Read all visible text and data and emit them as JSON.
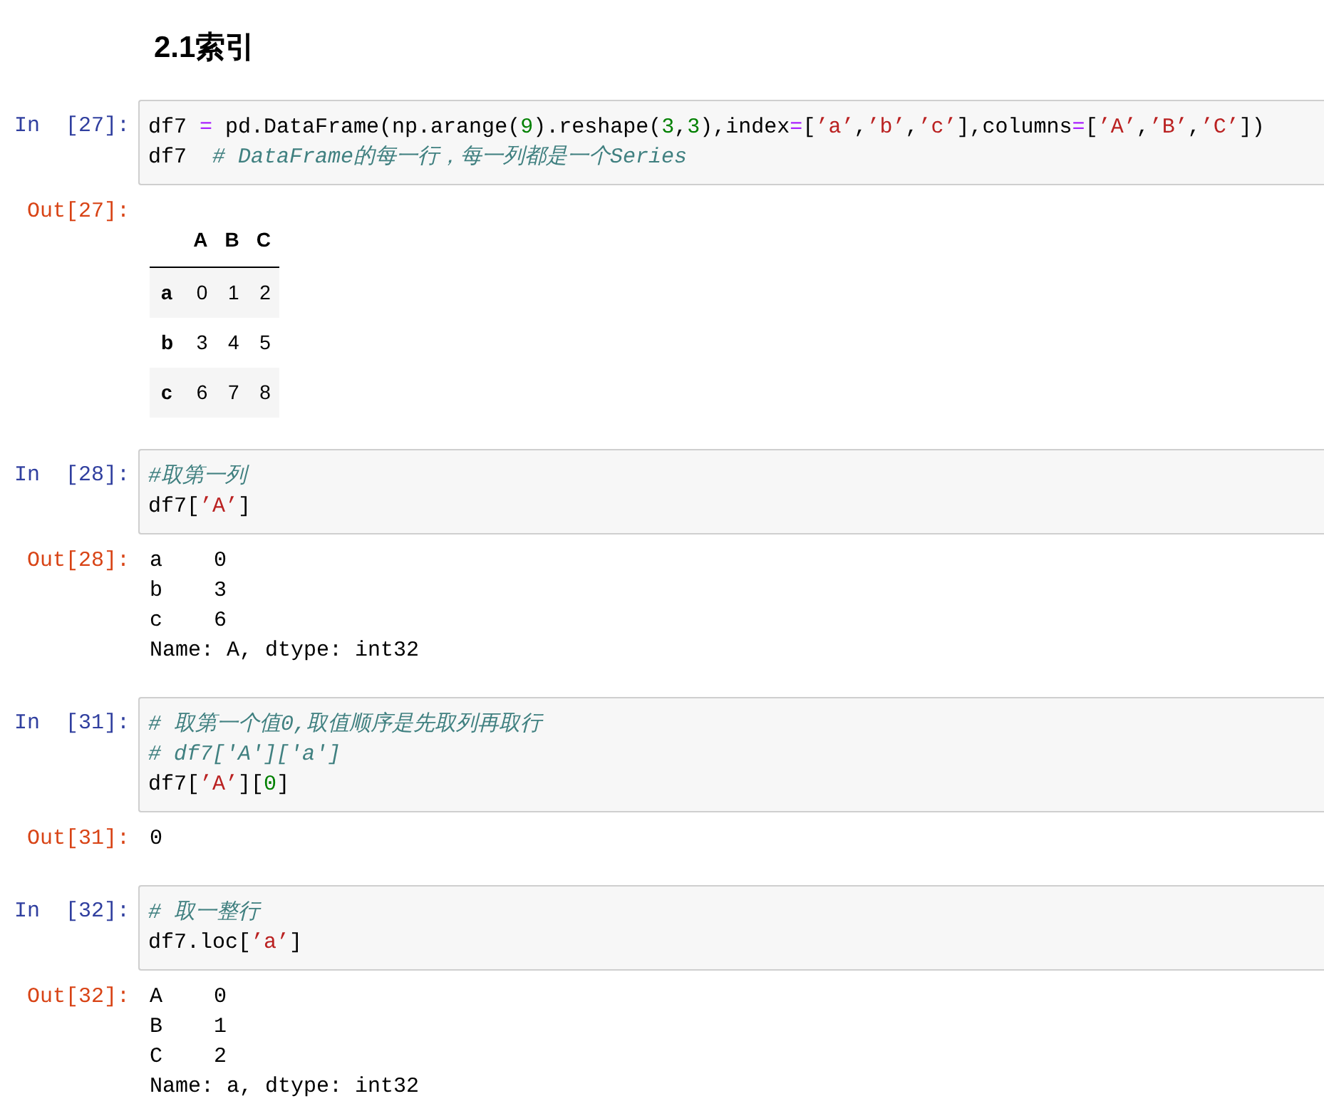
{
  "heading": "2.1索引",
  "cells": [
    {
      "in_prompt": "In  [27]:",
      "code": [
        [
          {
            "kind": "code",
            "text": "df7 "
          },
          {
            "kind": "operator",
            "text": "="
          },
          {
            "kind": "code",
            "text": " pd.DataFrame(np.arange("
          },
          {
            "kind": "number",
            "text": "9"
          },
          {
            "kind": "code",
            "text": ").reshape("
          },
          {
            "kind": "number",
            "text": "3"
          },
          {
            "kind": "code",
            "text": ","
          },
          {
            "kind": "number",
            "text": "3"
          },
          {
            "kind": "code",
            "text": "),index"
          },
          {
            "kind": "operator",
            "text": "="
          },
          {
            "kind": "code",
            "text": "["
          },
          {
            "kind": "string",
            "text": "’a’"
          },
          {
            "kind": "code",
            "text": ","
          },
          {
            "kind": "string",
            "text": "’b’"
          },
          {
            "kind": "code",
            "text": ","
          },
          {
            "kind": "string",
            "text": "’c’"
          },
          {
            "kind": "code",
            "text": "],columns"
          },
          {
            "kind": "operator",
            "text": "="
          },
          {
            "kind": "code",
            "text": "["
          },
          {
            "kind": "string",
            "text": "’A’"
          },
          {
            "kind": "code",
            "text": ","
          },
          {
            "kind": "string",
            "text": "’B’"
          },
          {
            "kind": "code",
            "text": ","
          },
          {
            "kind": "string",
            "text": "’C’"
          },
          {
            "kind": "code",
            "text": "])"
          }
        ],
        [
          {
            "kind": "code",
            "text": "df7  "
          },
          {
            "kind": "comment",
            "text": "# DataFrame的每一行，每一列都是一个Series"
          }
        ]
      ],
      "out_prompt": "Out[27]:",
      "output": {
        "kind": "table",
        "columns": [
          "A",
          "B",
          "C"
        ],
        "rows": [
          {
            "index": "a",
            "values": [
              "0",
              "1",
              "2"
            ]
          },
          {
            "index": "b",
            "values": [
              "3",
              "4",
              "5"
            ]
          },
          {
            "index": "c",
            "values": [
              "6",
              "7",
              "8"
            ]
          }
        ]
      }
    },
    {
      "in_prompt": "In  [28]:",
      "code": [
        [
          {
            "kind": "comment",
            "text": "#取第一列"
          }
        ],
        [
          {
            "kind": "code",
            "text": "df7["
          },
          {
            "kind": "string",
            "text": "’A’"
          },
          {
            "kind": "code",
            "text": "]"
          }
        ]
      ],
      "out_prompt": "Out[28]:",
      "output": {
        "kind": "text",
        "lines": [
          "a    0",
          "b    3",
          "c    6",
          "Name: A, dtype: int32"
        ]
      }
    },
    {
      "in_prompt": "In  [31]:",
      "code": [
        [
          {
            "kind": "comment",
            "text": "# 取第一个值0,取值顺序是先取列再取行"
          }
        ],
        [
          {
            "kind": "comment",
            "text": "# df7['A']['a']"
          }
        ],
        [
          {
            "kind": "code",
            "text": "df7["
          },
          {
            "kind": "string",
            "text": "’A’"
          },
          {
            "kind": "code",
            "text": "]["
          },
          {
            "kind": "number",
            "text": "0"
          },
          {
            "kind": "code",
            "text": "]"
          }
        ]
      ],
      "out_prompt": "Out[31]:",
      "output": {
        "kind": "text",
        "lines": [
          "0"
        ]
      }
    },
    {
      "in_prompt": "In  [32]:",
      "code": [
        [
          {
            "kind": "comment",
            "text": "# 取一整行"
          }
        ],
        [
          {
            "kind": "code",
            "text": "df7.loc["
          },
          {
            "kind": "string",
            "text": "’a’"
          },
          {
            "kind": "code",
            "text": "]"
          }
        ]
      ],
      "out_prompt": "Out[32]:",
      "output": {
        "kind": "text",
        "lines": [
          "A    0",
          "B    1",
          "C    2",
          "Name: a, dtype: int32"
        ]
      }
    }
  ]
}
